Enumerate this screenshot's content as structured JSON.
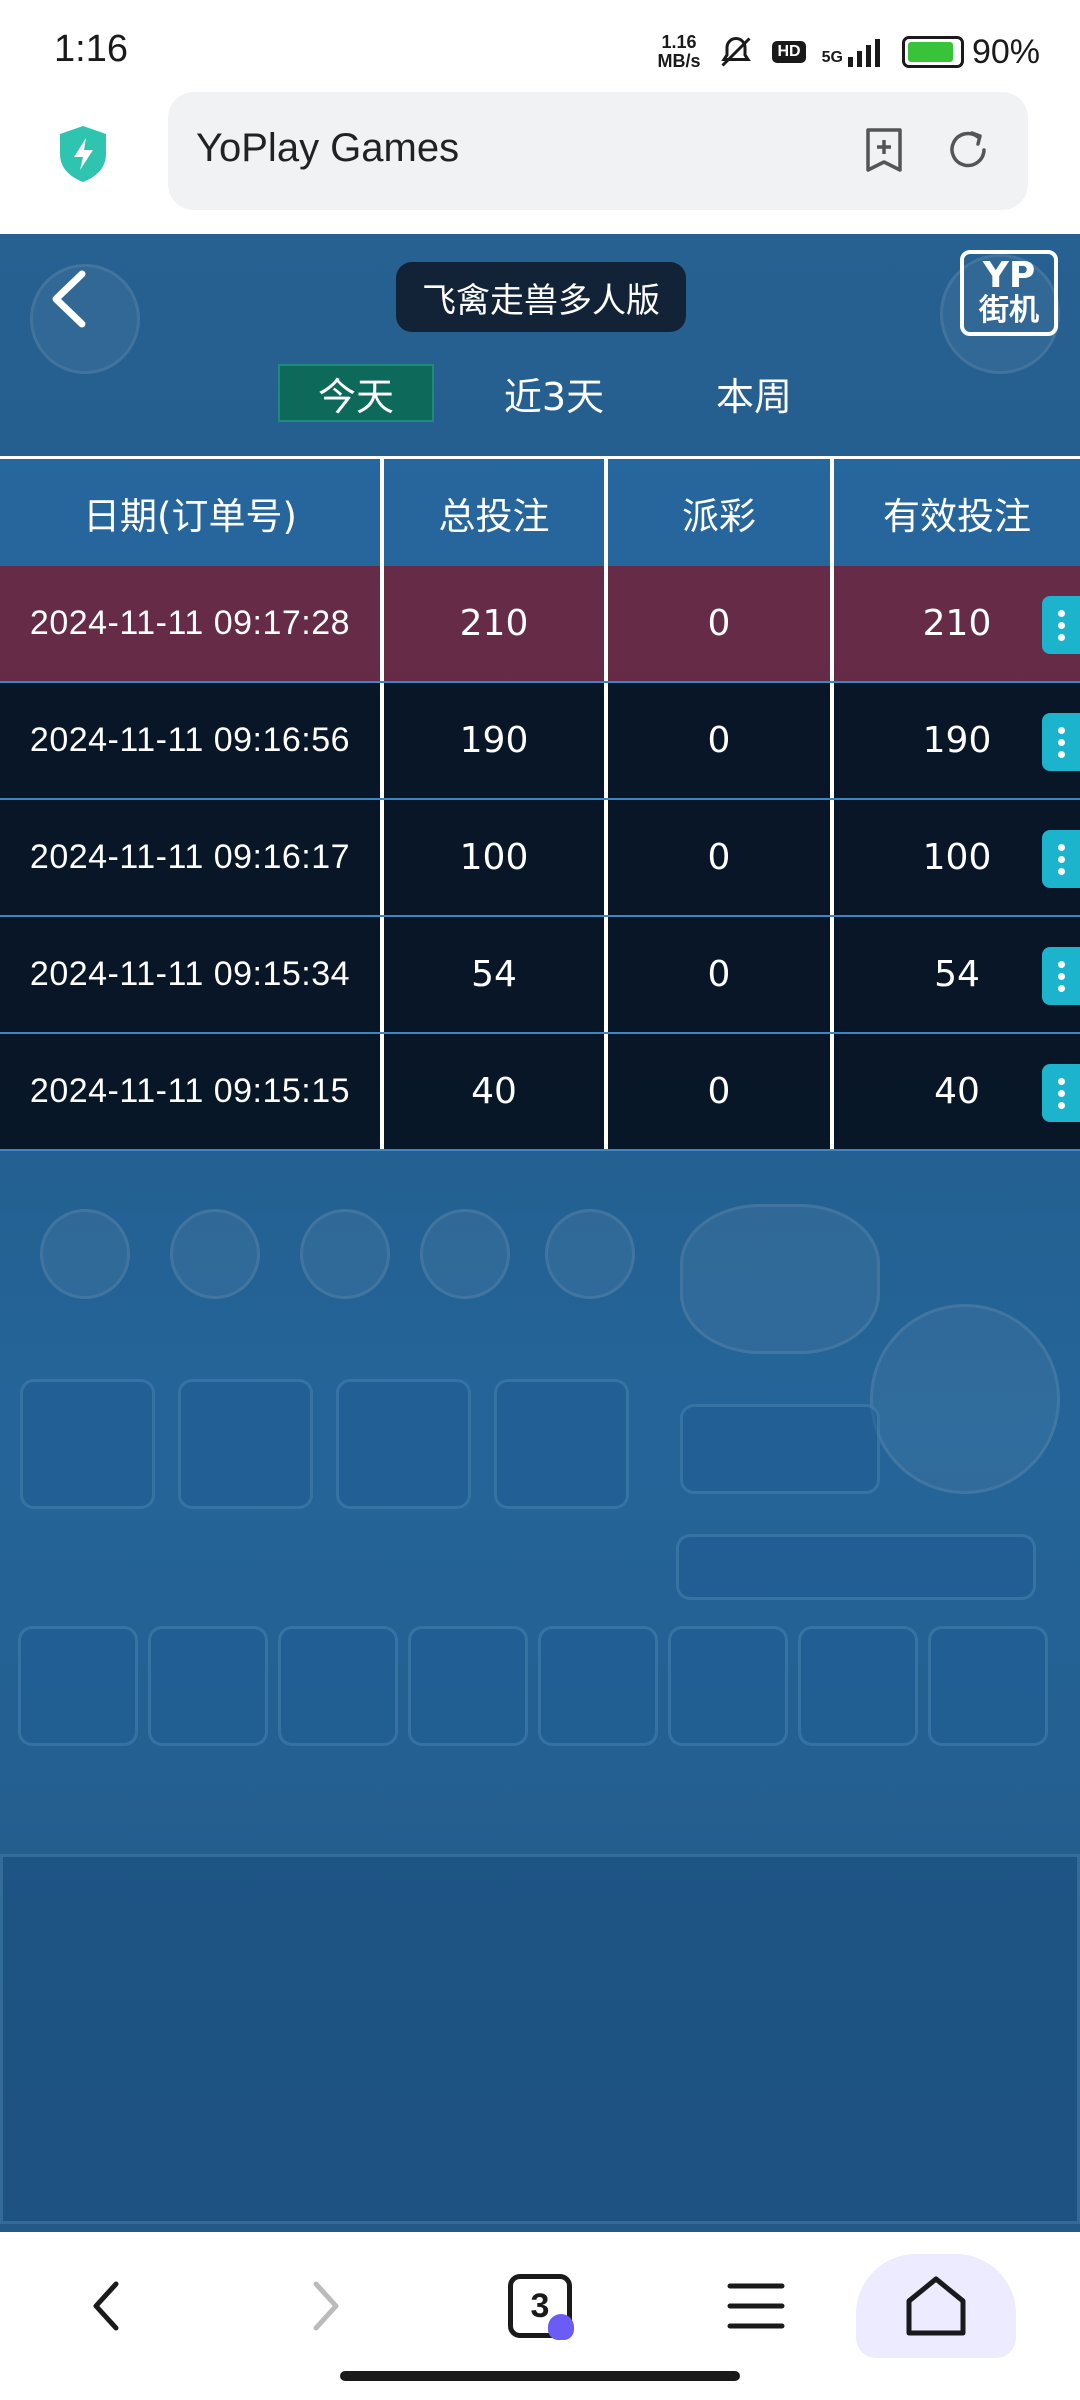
{
  "status_bar": {
    "time": "1:16",
    "net_speed_value": "1.16",
    "net_speed_unit": "MB/s",
    "hd": "HD",
    "signal": "5G",
    "battery": "90%",
    "battery_level": 0.9
  },
  "browser": {
    "url_text": "YoPlay Games",
    "tab_count": "3"
  },
  "game": {
    "title": "飞禽走兽多人版",
    "logo_line1": "YP",
    "logo_line2": "街机",
    "tabs": [
      {
        "label": "今天",
        "active": true
      },
      {
        "label": "近3天",
        "active": false
      },
      {
        "label": "本周",
        "active": false
      }
    ],
    "table": {
      "headers": [
        "日期(订单号)",
        "总投注",
        "派彩",
        "有效投注"
      ],
      "rows": [
        {
          "date": "2024-11-11 09:17:28",
          "total": "210",
          "payout": "0",
          "valid": "210"
        },
        {
          "date": "2024-11-11 09:16:56",
          "total": "190",
          "payout": "0",
          "valid": "190"
        },
        {
          "date": "2024-11-11 09:16:17",
          "total": "100",
          "payout": "0",
          "valid": "100"
        },
        {
          "date": "2024-11-11 09:15:34",
          "total": "54",
          "payout": "0",
          "valid": "54"
        },
        {
          "date": "2024-11-11 09:15:15",
          "total": "40",
          "payout": "0",
          "valid": "40"
        }
      ]
    }
  },
  "colors": {
    "accent_tab": "#0d6a5a",
    "highlight_row": "#781e32",
    "menu_button": "#1bb4cc"
  }
}
